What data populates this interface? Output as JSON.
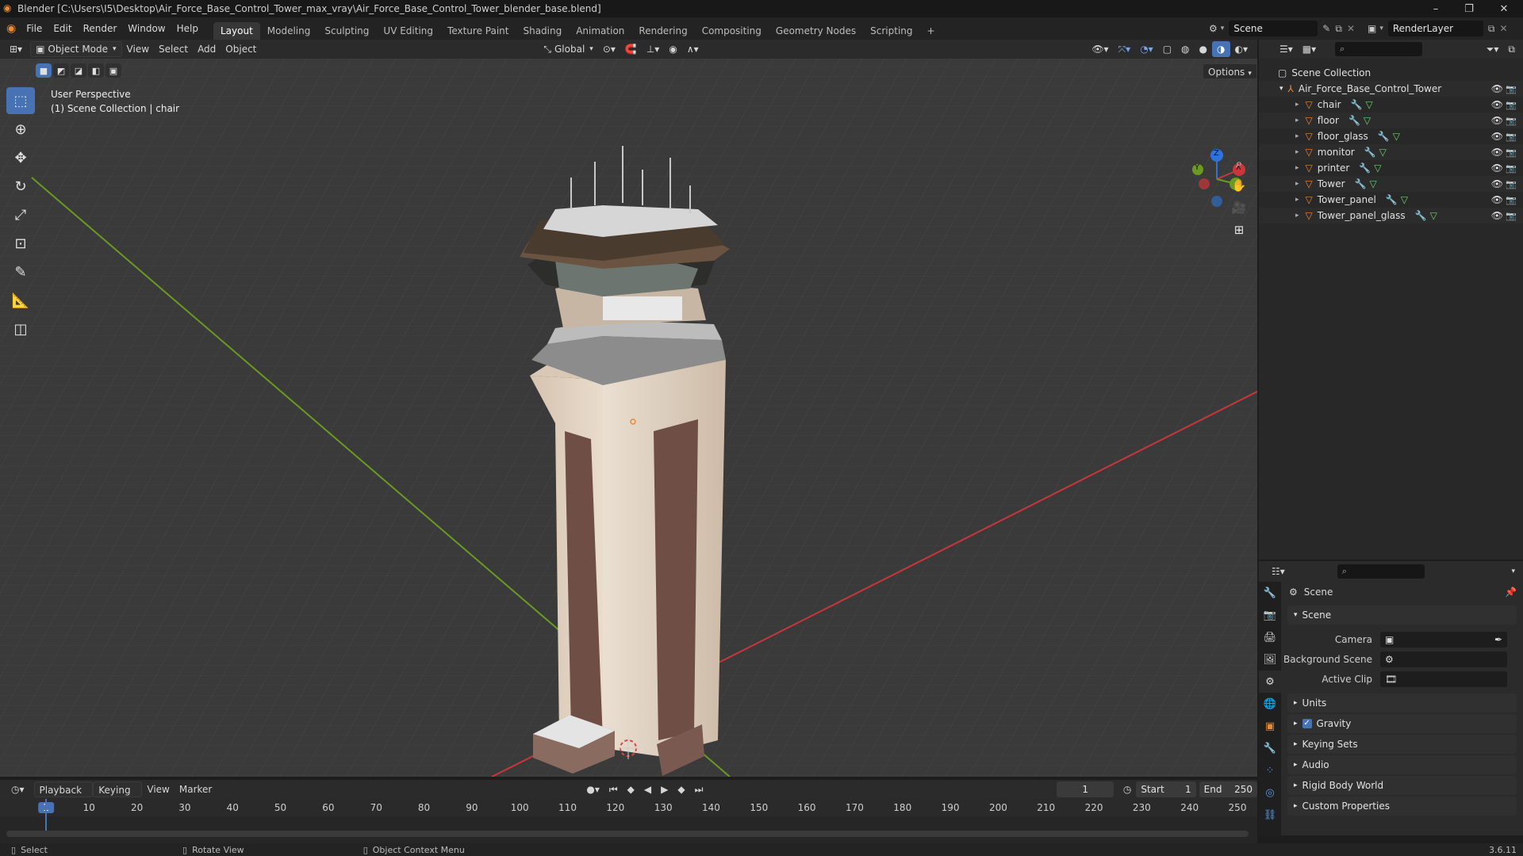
{
  "title_bar": {
    "title": "Blender [C:\\Users\\I5\\Desktop\\Air_Force_Base_Control_Tower_max_vray\\Air_Force_Base_Control_Tower_blender_base.blend]",
    "minimize": "–",
    "maximize": "❐",
    "close": "✕"
  },
  "menus": [
    "File",
    "Edit",
    "Render",
    "Window",
    "Help"
  ],
  "workspaces": [
    "Layout",
    "Modeling",
    "Sculpting",
    "UV Editing",
    "Texture Paint",
    "Shading",
    "Animation",
    "Rendering",
    "Compositing",
    "Geometry Nodes",
    "Scripting",
    "+"
  ],
  "active_workspace": "Layout",
  "scene_selector": {
    "label": "Scene"
  },
  "render_layer": {
    "label": "RenderLayer"
  },
  "viewport_header": {
    "mode": "Object Mode",
    "menus": [
      "View",
      "Select",
      "Add",
      "Object"
    ],
    "transform_orientation": "Global",
    "options": "Options"
  },
  "viewport": {
    "view_name": "User Perspective",
    "collection_info": "(1) Scene Collection | chair"
  },
  "gizmo": {
    "x": "X",
    "y": "Y",
    "z": "Z"
  },
  "outliner": {
    "root": "Scene Collection",
    "collection": "Air_Force_Base_Control_Tower",
    "objects": [
      {
        "name": "chair"
      },
      {
        "name": "floor"
      },
      {
        "name": "floor_glass"
      },
      {
        "name": "monitor"
      },
      {
        "name": "printer"
      },
      {
        "name": "Tower"
      },
      {
        "name": "Tower_panel"
      },
      {
        "name": "Tower_panel_glass"
      }
    ]
  },
  "properties": {
    "context": "Scene",
    "section": "Scene",
    "fields": [
      {
        "label": "Camera"
      },
      {
        "label": "Background Scene"
      },
      {
        "label": "Active Clip"
      }
    ],
    "panels": [
      {
        "label": "Units",
        "checkbox": false
      },
      {
        "label": "Gravity",
        "checkbox": true
      },
      {
        "label": "Keying Sets",
        "checkbox": false
      },
      {
        "label": "Audio",
        "checkbox": false
      },
      {
        "label": "Rigid Body World",
        "checkbox": false
      },
      {
        "label": "Custom Properties",
        "checkbox": false
      }
    ]
  },
  "timeline": {
    "menus": [
      "Playback",
      "Keying",
      "View",
      "Marker"
    ],
    "current_frame": "1",
    "start_label": "Start",
    "start": "1",
    "end_label": "End",
    "end": "250",
    "ticks": [
      "1",
      "10",
      "20",
      "30",
      "40",
      "50",
      "60",
      "70",
      "80",
      "90",
      "100",
      "110",
      "120",
      "130",
      "140",
      "150",
      "160",
      "170",
      "180",
      "190",
      "200",
      "210",
      "220",
      "230",
      "240",
      "250"
    ]
  },
  "status_bar": {
    "select": "Select",
    "rotate": "Rotate View",
    "context_menu": "Object Context Menu",
    "version": "3.6.11"
  },
  "colors": {
    "accent": "#4772b3",
    "x_axis": "#c9363b",
    "y_axis": "#6a9a22",
    "z_axis": "#2f73d8",
    "mesh_icon": "#e58a36"
  }
}
